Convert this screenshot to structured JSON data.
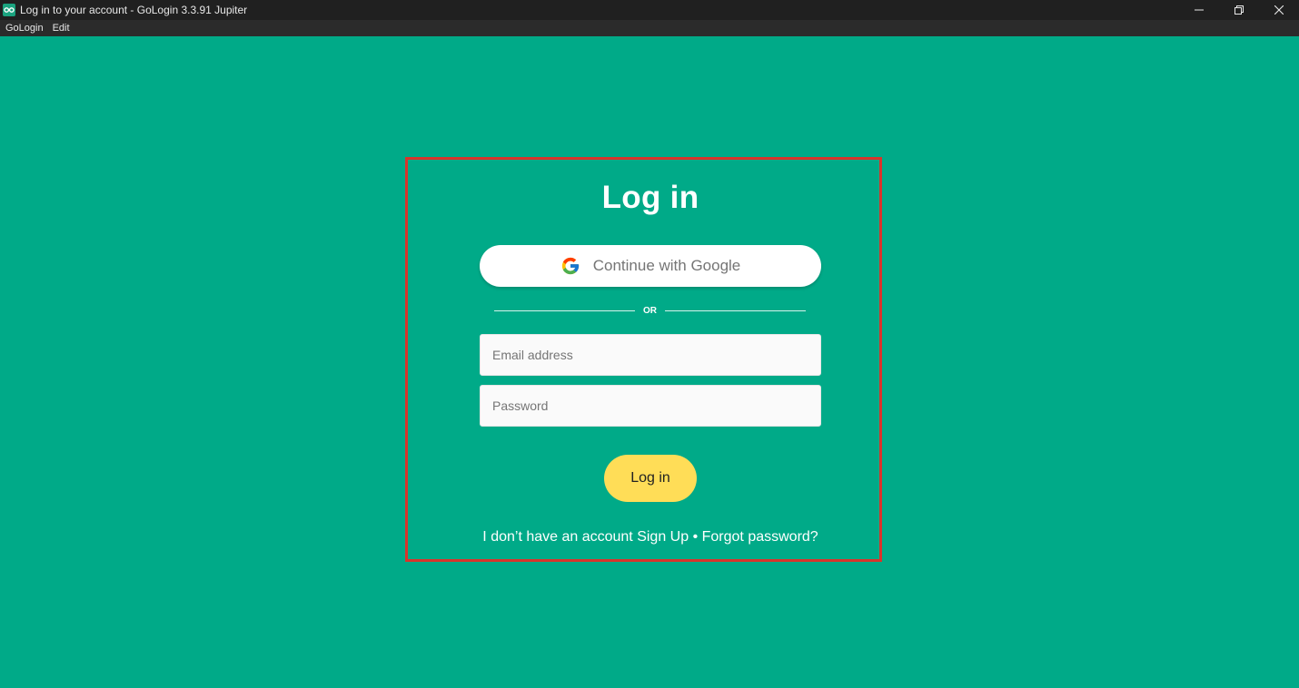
{
  "window": {
    "title": "Log in to your account - GoLogin 3.3.91 Jupiter",
    "icon": "gologin-app-icon",
    "controls": [
      "minimize-icon",
      "restore-icon",
      "close-icon"
    ]
  },
  "menu": {
    "items": [
      "GoLogin",
      "Edit"
    ]
  },
  "login": {
    "title": "Log in",
    "google_button_label": "Continue with Google",
    "divider_text": "OR",
    "email_placeholder": "Email address",
    "password_placeholder": "Password",
    "submit_label": "Log in",
    "no_account_text": "I don’t have an account",
    "signup_link": "Sign Up",
    "separator": " • ",
    "forgot_link": "Forgot password?"
  },
  "colors": {
    "background": "#00aa88",
    "highlight_border": "#d9342b",
    "login_button": "#ffdd57",
    "titlebar": "#202020"
  }
}
